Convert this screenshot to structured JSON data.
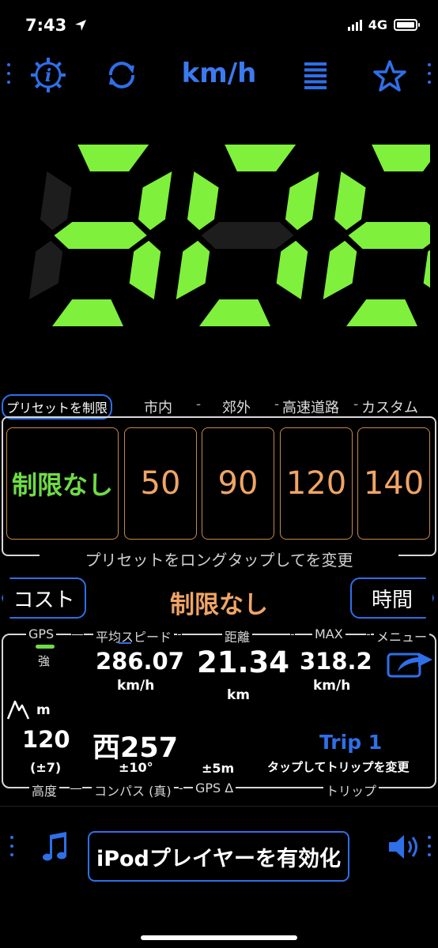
{
  "status_bar": {
    "time": "7:43",
    "network": "4G"
  },
  "toolbar": {
    "unit": "km/h"
  },
  "speed": {
    "value": 308
  },
  "presets": {
    "header_label": "プリセットを制限",
    "header_cats": [
      "市内",
      "郊外",
      "高速道路",
      "カスタム"
    ],
    "values": [
      "制限なし",
      "50",
      "90",
      "120",
      "140"
    ],
    "footer": "プリセットをロングタップしてを変更"
  },
  "mode": {
    "cost_label": "コスト",
    "status": "制限なし",
    "time_label": "時間"
  },
  "stats": {
    "gps_label": "GPS",
    "gps_strength": "強",
    "avg_speed_label": "平均スピード",
    "avg_speed": "286.07",
    "avg_speed_unit": "km/h",
    "distance_label": "距離",
    "distance": "21.34",
    "distance_unit": "km",
    "max_label": "MAX",
    "max_speed": "318.2",
    "max_unit": "km/h",
    "menu_label": "メニュー",
    "altitude_unit": "m",
    "altitude": "120",
    "altitude_acc": "(±7)",
    "altitude_label": "高度",
    "compass": "西257",
    "compass_acc": "±10°",
    "compass_label": "コンパス (真)",
    "gps_delta": "±5m",
    "gps_delta_label": "GPS Δ",
    "trip_name": "Trip 1",
    "trip_hint": "タップしてトリップを変更",
    "trip_label": "トリップ"
  },
  "bottom": {
    "ipod_label": "iPodプレイヤーを有効化"
  },
  "colors": {
    "accent": "#2f6fe8",
    "digit_green": "#7ff03c",
    "preset_orange": "#f0a565",
    "status_green": "#6fdc45"
  }
}
